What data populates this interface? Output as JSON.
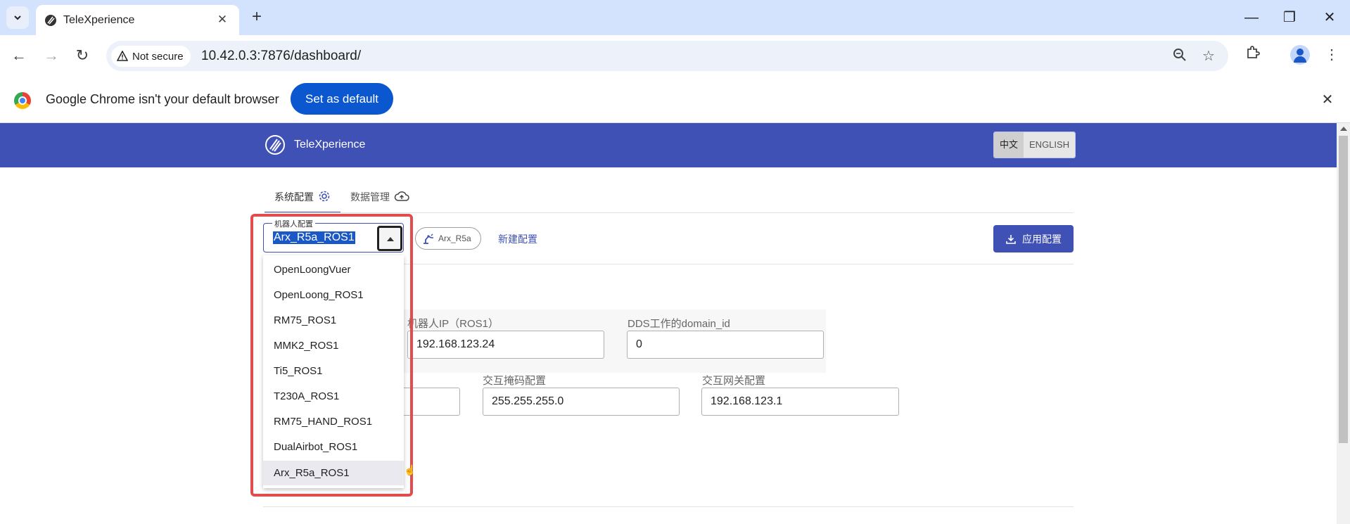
{
  "browser": {
    "tab_title": "TeleXperience",
    "security_label": "Not secure",
    "url": "10.42.0.3:7876/dashboard/"
  },
  "infobar": {
    "message": "Google Chrome isn't your default browser",
    "button_label": "Set as default"
  },
  "app": {
    "title": "TeleXperience",
    "languages": [
      "中文",
      "ENGLISH"
    ],
    "active_language": "中文",
    "accent_color": "#3f51b5"
  },
  "tabs": [
    {
      "label": "系统配置",
      "icon": "gear-icon",
      "active": true
    },
    {
      "label": "数据管理",
      "icon": "cloud-upload-icon",
      "active": false
    }
  ],
  "config": {
    "select_label": "机器人配置",
    "select_value": "Arx_R5a_ROS1",
    "chip_label": "Arx_R5a",
    "new_config_label": "新建配置",
    "apply_label": "应用配置"
  },
  "fields": {
    "robot_ip_label": "机器人IP（ROS1）",
    "robot_ip_value": "192.168.123.24",
    "dds_label": "DDS工作的domain_id",
    "dds_value": "0",
    "mask_label": "交互掩码配置",
    "mask_value": "255.255.255.0",
    "gateway_label": "交互网关配置",
    "gateway_value": "192.168.123.1"
  },
  "dropdown_options": [
    "OpenLoongVuer",
    "OpenLoong_ROS1",
    "RM75_ROS1",
    "MMK2_ROS1",
    "Ti5_ROS1",
    "T230A_ROS1",
    "RM75_HAND_ROS1",
    "DualAirbot_ROS1",
    "Arx_R5a_ROS1"
  ],
  "dropdown_selected": "Arx_R5a_ROS1"
}
